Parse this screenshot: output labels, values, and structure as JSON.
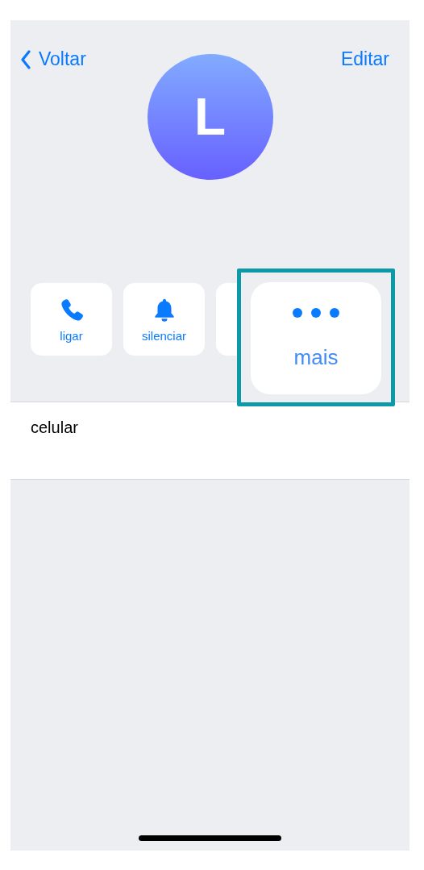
{
  "nav": {
    "back_label": "Voltar",
    "edit_label": "Editar"
  },
  "avatar": {
    "initial": "L"
  },
  "actions": [
    {
      "kind": "phone",
      "label": "ligar"
    },
    {
      "kind": "bell",
      "label": "silenciar"
    }
  ],
  "highlighted_action": {
    "kind": "more",
    "label": "mais"
  },
  "field": {
    "label": "celular"
  }
}
